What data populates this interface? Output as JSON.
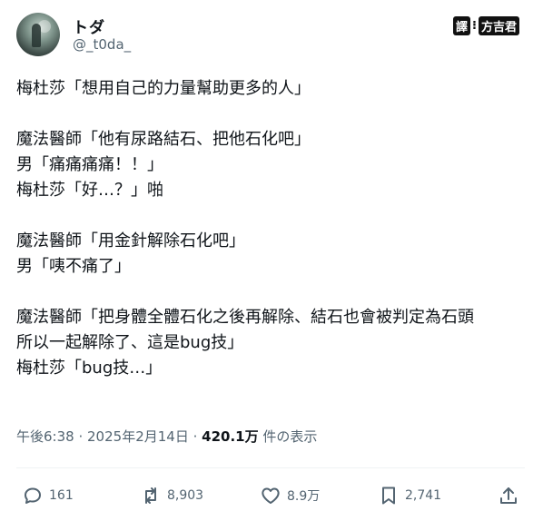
{
  "author": {
    "name": "トダ",
    "handle": "@_t0da_"
  },
  "translator_tag": {
    "left": "譯",
    "sep": "⁝",
    "right": "方吉君"
  },
  "post": {
    "lines": [
      "梅杜莎「想用自己的力量幫助更多的人」",
      "",
      "魔法醫師「他有尿路結石、把他石化吧」",
      "男「痛痛痛痛！！」",
      "梅杜莎「好…？」啪",
      "",
      "魔法醫師「用金針解除石化吧」",
      "男「咦不痛了」",
      "",
      "魔法醫師「把身體全體石化之後再解除、結石也會被判定為石頭",
      "所以一起解除了、這是bug技」",
      "梅杜莎「bug技…」"
    ]
  },
  "meta": {
    "time": "午後6:38",
    "date": "2025年2月14日",
    "views_count": "420.1万",
    "views_label": "件の表示"
  },
  "actions": {
    "reply_count": "161",
    "repost_count": "8,903",
    "like_count": "8.9万",
    "bookmark_count": "2,741"
  }
}
